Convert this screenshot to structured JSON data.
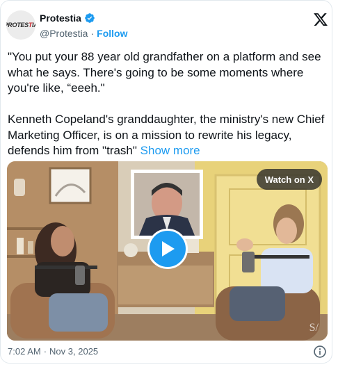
{
  "account": {
    "avatar_text": "PROTESTIA",
    "name": "Protestia",
    "handle": "@Protestia",
    "separator": "·",
    "follow_label": "Follow"
  },
  "tweet": {
    "paragraph1": "\"You put your 88 year old grandfather on a platform and see what he says. There's going to be some moments where you're like, “eeeh.\"",
    "paragraph2": "Kenneth Copeland's granddaughter, the ministry's new Chief Marketing Officer, is on a mission to rewrite his legacy, defends him from \"trash\"",
    "show_more_label": "Show more"
  },
  "media": {
    "watch_label": "Watch on X",
    "watermark": "S/"
  },
  "meta": {
    "time": "7:02 AM",
    "separator": "·",
    "date": "Nov 3, 2025"
  },
  "icons": {
    "verified": "verified-badge-icon",
    "x_logo": "x-logo-icon",
    "play": "play-icon",
    "info": "info-icon"
  },
  "colors": {
    "accent": "#1d9bf0",
    "text": "#0f1419",
    "muted": "#536471"
  }
}
